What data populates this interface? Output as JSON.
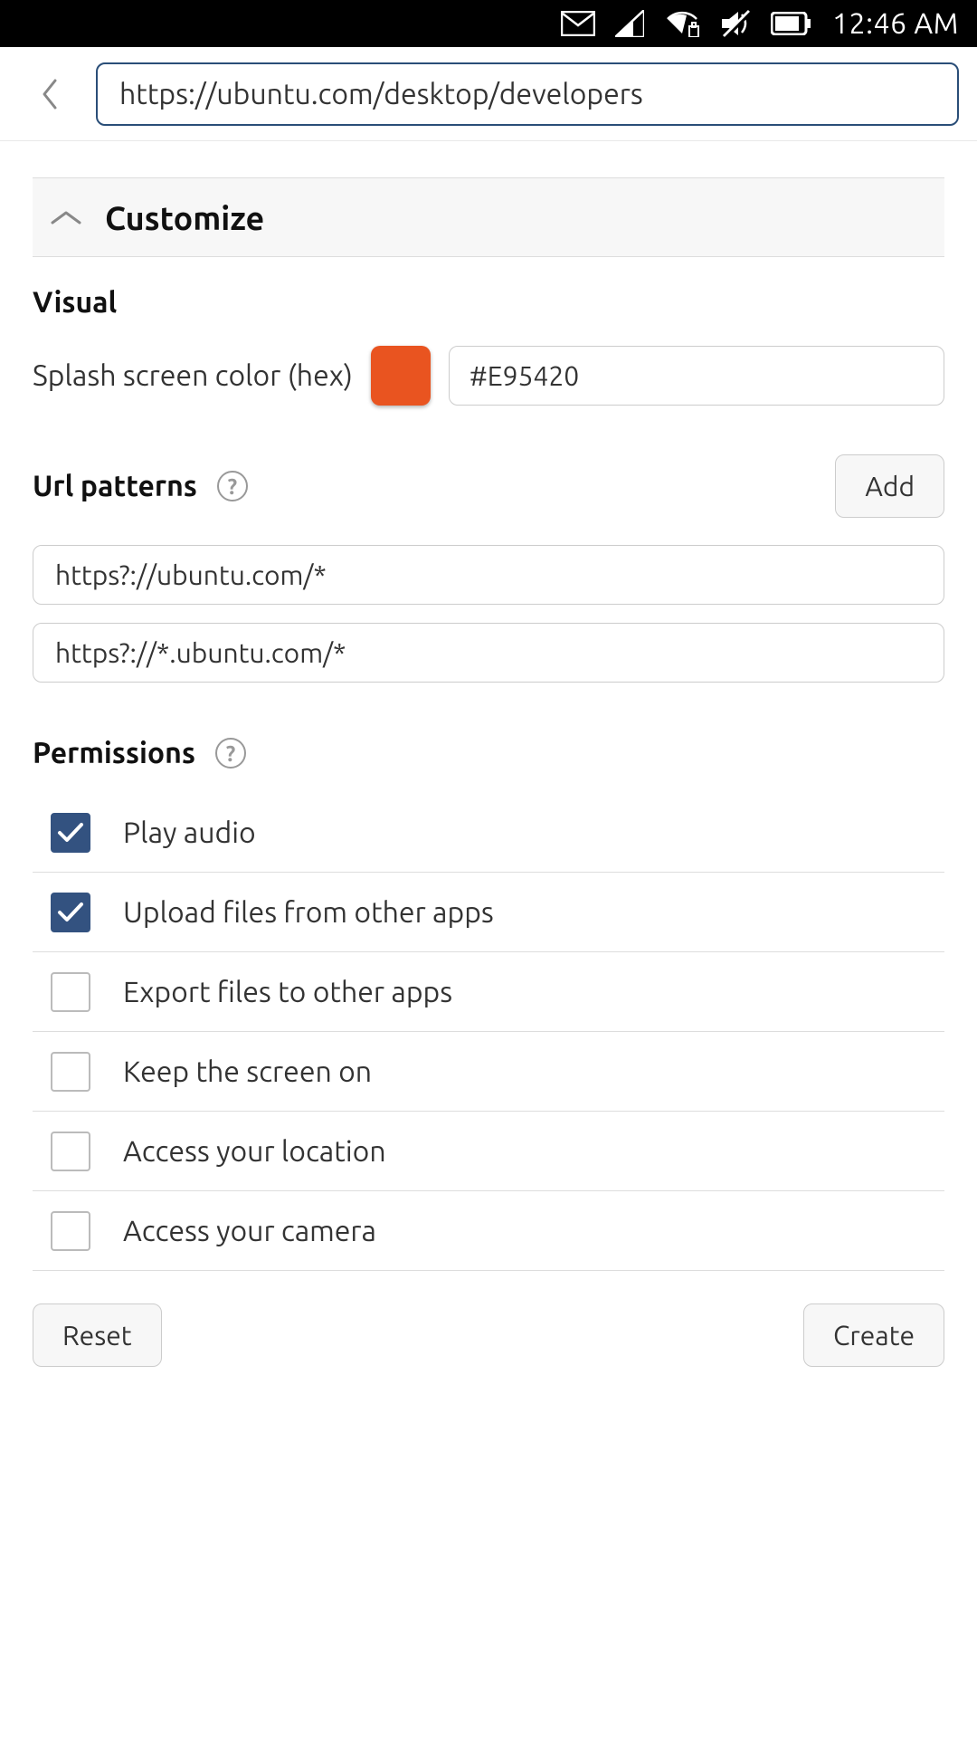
{
  "status_bar": {
    "time": "12:46 AM"
  },
  "url_bar": {
    "url": "https://ubuntu.com/desktop/developers"
  },
  "accordion": {
    "title": "Customize"
  },
  "visual": {
    "heading": "Visual",
    "splash_label": "Splash screen color (hex)",
    "splash_hex": "#E95420"
  },
  "url_patterns": {
    "heading": "Url patterns",
    "add_label": "Add",
    "patterns": [
      "https?://ubuntu.com/*",
      "https?://*.ubuntu.com/*"
    ]
  },
  "permissions": {
    "heading": "Permissions",
    "items": [
      {
        "label": "Play audio",
        "checked": true
      },
      {
        "label": "Upload files from other apps",
        "checked": true
      },
      {
        "label": "Export files to other apps",
        "checked": false
      },
      {
        "label": "Keep the screen on",
        "checked": false
      },
      {
        "label": "Access your location",
        "checked": false
      },
      {
        "label": "Access your camera",
        "checked": false
      }
    ]
  },
  "footer": {
    "reset_label": "Reset",
    "create_label": "Create"
  },
  "colors": {
    "splash": "#E95420"
  }
}
